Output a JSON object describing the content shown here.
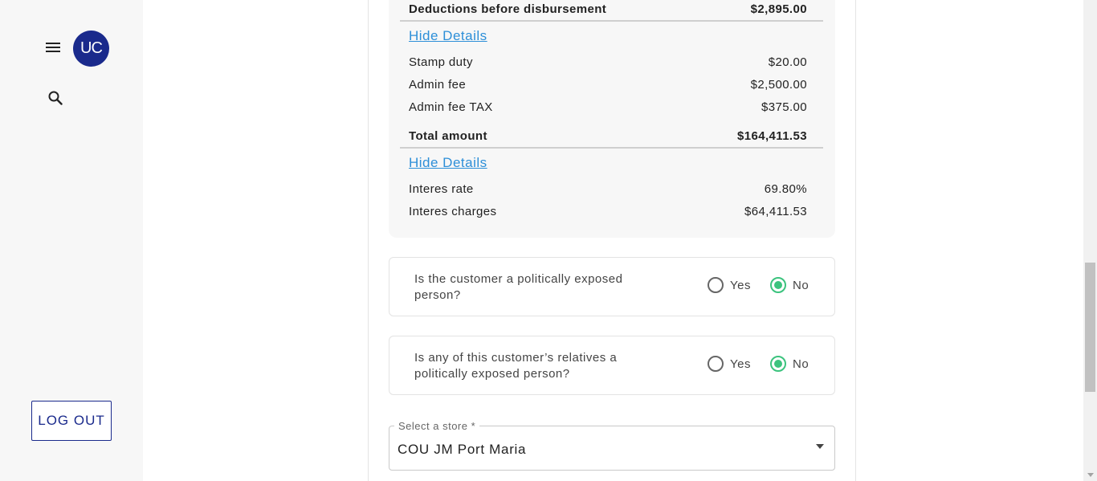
{
  "sidebar": {
    "avatar_initials": "UC",
    "logout_label": "LOG OUT",
    "menu_icon": "hamburger-menu-icon",
    "search_icon": "search-icon",
    "brand_color": "#1a2a8c"
  },
  "summary": {
    "deductions_label": "Deductions before disbursement",
    "deductions_value": "$2,895.00",
    "hide_details_1": "Hide Details",
    "stamp_duty_label": "Stamp duty",
    "stamp_duty_value": "$20.00",
    "admin_fee_label": "Admin fee",
    "admin_fee_value": "$2,500.00",
    "admin_fee_tax_label": "Admin fee TAX",
    "admin_fee_tax_value": "$375.00",
    "total_label": "Total amount",
    "total_value": "$164,411.53",
    "hide_details_2": "Hide Details",
    "interest_rate_label": "Interes rate",
    "interest_rate_value": "69.80%",
    "interest_charges_label": "Interes charges",
    "interest_charges_value": "$64,411.53"
  },
  "questions": [
    {
      "text": "Is the customer a politically exposed person?",
      "yes_label": "Yes",
      "no_label": "No",
      "selected": "No"
    },
    {
      "text": "Is any of this customer’s relatives a politically exposed person?",
      "yes_label": "Yes",
      "no_label": "No",
      "selected": "No"
    }
  ],
  "store_select": {
    "label": "Select a store *",
    "value": "COU JM Port Maria"
  },
  "colors": {
    "link": "#2d8fd8",
    "radio_selected": "#3cc37e"
  }
}
